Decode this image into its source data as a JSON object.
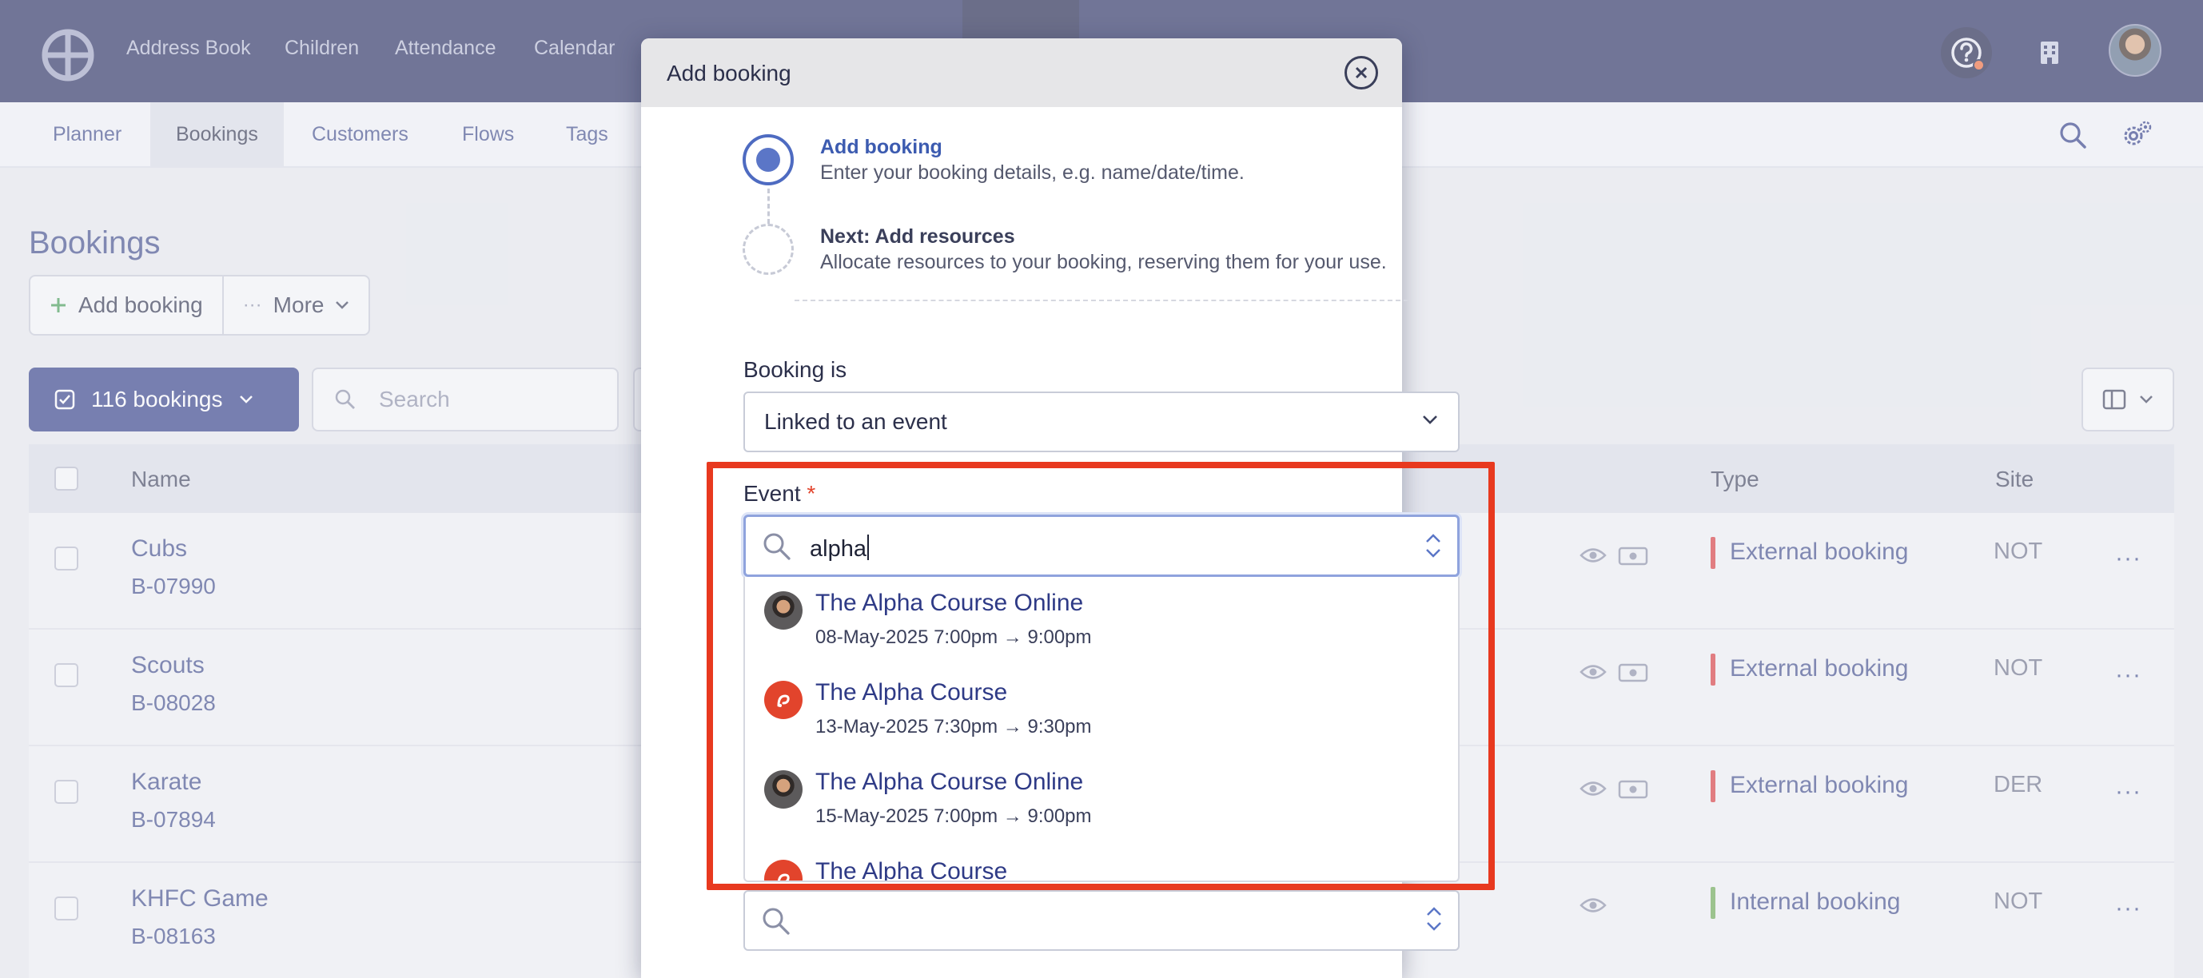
{
  "topnav": {
    "links": [
      "Address Book",
      "Children",
      "Attendance",
      "Calendar"
    ]
  },
  "subnav": {
    "tabs": [
      "Planner",
      "Bookings",
      "Customers",
      "Flows",
      "Tags"
    ],
    "active_tab": "Bookings"
  },
  "page": {
    "title": "Bookings",
    "add_booking_label": "Add booking",
    "more_label": "More",
    "bookings_count_label": "116 bookings",
    "search_placeholder": "Search"
  },
  "table": {
    "headers": {
      "name": "Name",
      "type": "Type",
      "site": "Site"
    },
    "rows": [
      {
        "name": "Cubs",
        "ref": "B-07990",
        "type": "External booking",
        "type_color": "#d9383a",
        "site": "NOT",
        "icons": [
          "eye-icon",
          "money-icon"
        ]
      },
      {
        "name": "Scouts",
        "ref": "B-08028",
        "type": "External booking",
        "type_color": "#d9383a",
        "site": "NOT",
        "icons": [
          "eye-icon",
          "money-icon"
        ]
      },
      {
        "name": "Karate",
        "ref": "B-07894",
        "type": "External booking",
        "type_color": "#d9383a",
        "site": "DER",
        "icons": [
          "eye-icon",
          "money-icon"
        ]
      },
      {
        "name": "KHFC Game",
        "ref": "B-08163",
        "type": "Internal booking",
        "type_color": "#6aa84f",
        "site": "NOT",
        "icons": [
          "eye-icon"
        ]
      }
    ]
  },
  "modal": {
    "title": "Add booking",
    "steps": [
      {
        "title": "Add booking",
        "description": "Enter your booking details, e.g. name/date/time.",
        "state": "active"
      },
      {
        "title": "Next: Add resources",
        "description": "Allocate resources to your booking, reserving them for your use.",
        "state": "upcoming"
      }
    ],
    "booking_is_label": "Booking is",
    "booking_is_value": "Linked to an event",
    "event_label": "Event",
    "event_required_mark": "*",
    "event_search_value": "alpha",
    "event_options": [
      {
        "title": "The Alpha Course Online",
        "datetime": "08-May-2025 7:00pm → 9:00pm",
        "icon": "host-photo-icon"
      },
      {
        "title": "The Alpha Course",
        "datetime": "13-May-2025 7:30pm → 9:30pm",
        "icon": "alpha-logo-icon"
      },
      {
        "title": "The Alpha Course Online",
        "datetime": "15-May-2025 7:00pm → 9:00pm",
        "icon": "host-photo-icon"
      },
      {
        "title": "The Alpha Course",
        "datetime": "",
        "icon": "alpha-logo-icon"
      }
    ]
  },
  "colors": {
    "nav_bg": "#252a5e",
    "primary": "#2e3a86",
    "highlight": "#e8391f",
    "external_booking": "#d9383a",
    "internal_booking": "#6aa84f"
  }
}
